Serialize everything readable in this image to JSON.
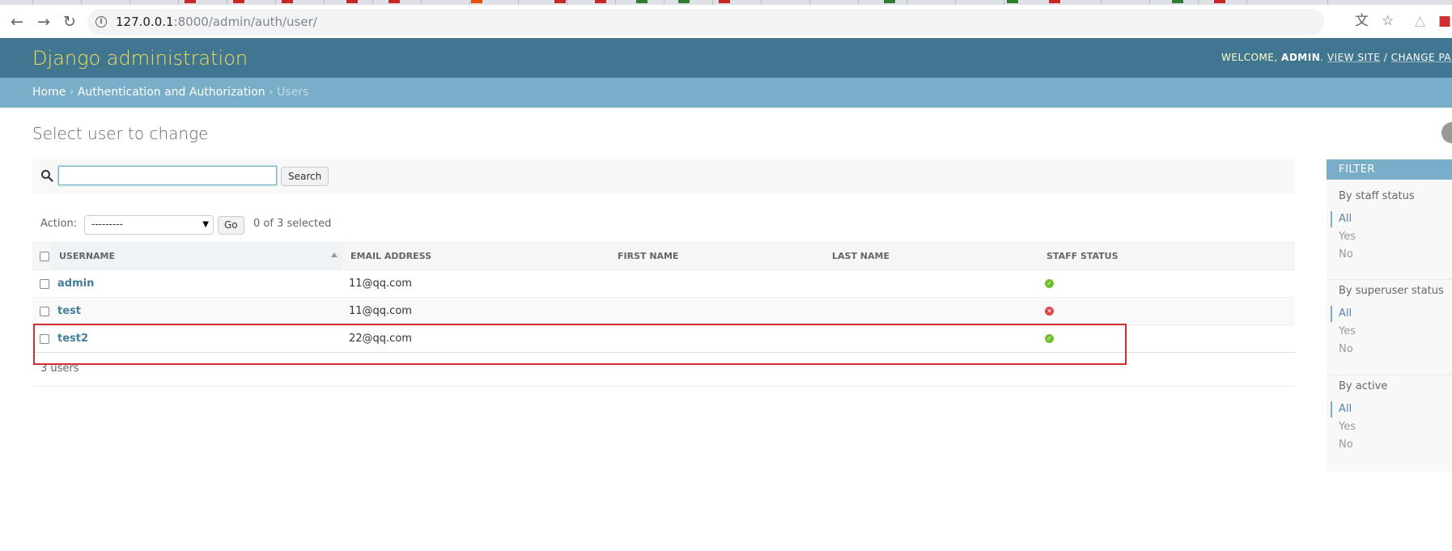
{
  "browser": {
    "url_host": "127.0.0.1",
    "url_rest": ":8000/admin/auth/user/"
  },
  "header": {
    "site_name": "Django administration",
    "welcome": "WELCOME,",
    "username": "ADMIN",
    "view_site": "VIEW SITE",
    "separator": "/",
    "change_password": "CHANGE PASSWORD"
  },
  "breadcrumbs": {
    "home": "Home",
    "sep": "›",
    "app": "Authentication and Authorization",
    "current": "Users"
  },
  "page": {
    "title": "Select user to change"
  },
  "search": {
    "value": "",
    "button": "Search"
  },
  "actions": {
    "label": "Action:",
    "selected_option": "---------",
    "go": "Go",
    "counter": "0 of 3 selected"
  },
  "table": {
    "columns": [
      "USERNAME",
      "EMAIL ADDRESS",
      "FIRST NAME",
      "LAST NAME",
      "STAFF STATUS"
    ],
    "rows": [
      {
        "username": "admin",
        "email": "11@qq.com",
        "first_name": "",
        "last_name": "",
        "staff": true
      },
      {
        "username": "test",
        "email": "11@qq.com",
        "first_name": "",
        "last_name": "",
        "staff": false
      },
      {
        "username": "test2",
        "email": "22@qq.com",
        "first_name": "",
        "last_name": "",
        "staff": true
      }
    ]
  },
  "paginator": {
    "text": "3 users"
  },
  "filter": {
    "title": "FILTER",
    "groups": [
      {
        "title": "By staff status",
        "options": [
          "All",
          "Yes",
          "No"
        ]
      },
      {
        "title": "By superuser status",
        "options": [
          "All",
          "Yes",
          "No"
        ]
      },
      {
        "title": "By active",
        "options": [
          "All",
          "Yes",
          "No"
        ]
      }
    ]
  },
  "colors": {
    "header_bg": "#417690",
    "branding": "#f5dd5d",
    "breadcrumbs_bg": "#79aec8",
    "link": "#447e9b",
    "highlight": "#d32f2f"
  }
}
